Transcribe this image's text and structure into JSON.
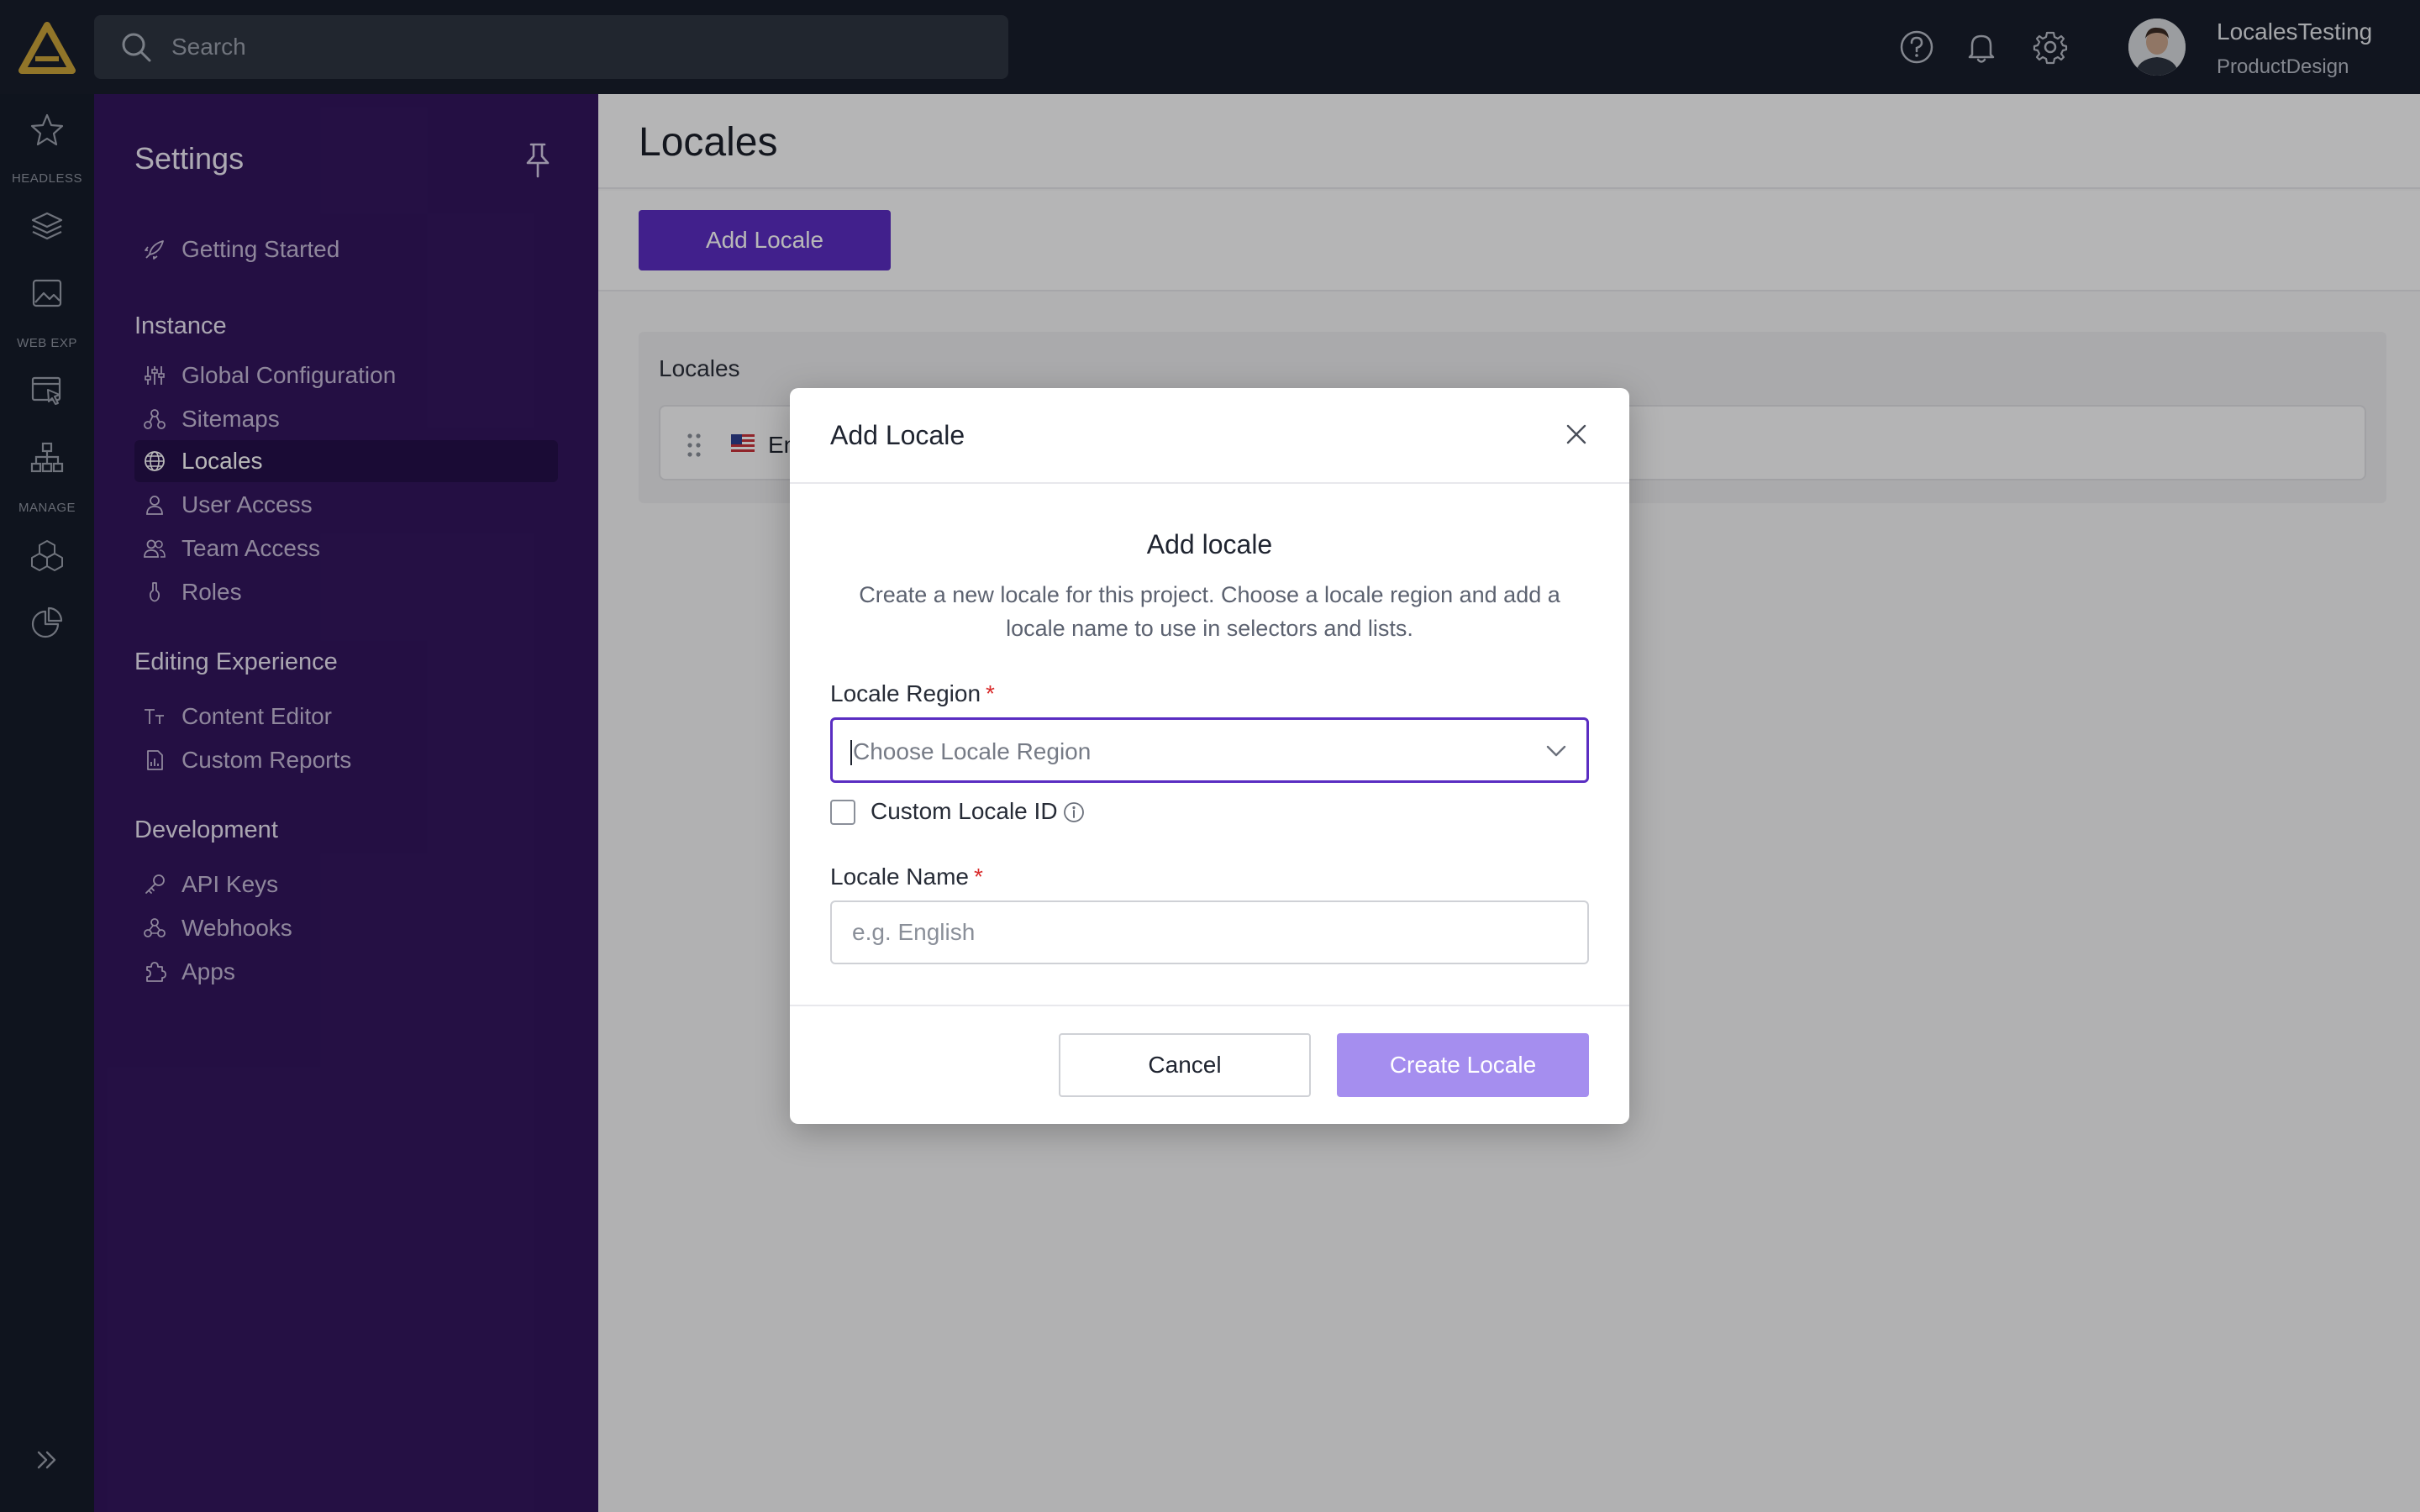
{
  "topbar": {
    "search_placeholder": "Search",
    "icons": [
      "help-icon",
      "bell-icon",
      "gear-icon"
    ],
    "user": {
      "name": "LocalesTesting",
      "org": "ProductDesign"
    }
  },
  "rail": {
    "labels": {
      "headless": "HEADLESS",
      "web_exp": "WEB EXP",
      "manage": "MANAGE"
    },
    "icons": [
      "star-icon",
      "layers-icon",
      "image-icon",
      "web-experience-icon",
      "sitemap-icon",
      "cubes-icon",
      "pie-chart-icon",
      "expand-icon"
    ]
  },
  "settings": {
    "title": "Settings",
    "getting_started": "Getting Started",
    "groups": {
      "instance": {
        "title": "Instance",
        "items": [
          "Global Configuration",
          "Sitemaps",
          "Locales",
          "User Access",
          "Team Access",
          "Roles"
        ]
      },
      "editing": {
        "title": "Editing Experience",
        "items": [
          "Content Editor",
          "Custom Reports"
        ]
      },
      "development": {
        "title": "Development",
        "items": [
          "API Keys",
          "Webhooks",
          "Apps"
        ]
      }
    },
    "active_item": "Locales"
  },
  "main": {
    "page_title": "Locales",
    "add_button": "Add Locale",
    "card_title": "Locales",
    "row_label": "En"
  },
  "modal": {
    "title": "Add Locale",
    "heading": "Add locale",
    "description": "Create a new locale for this project. Choose a locale region and add a locale name to use in selectors and lists.",
    "region_label": "Locale Region",
    "region_placeholder": "Choose Locale Region",
    "required_mark": "*",
    "custom_id_label": "Custom Locale ID",
    "name_label": "Locale Name",
    "name_placeholder": "e.g. English",
    "cancel": "Cancel",
    "create": "Create Locale"
  },
  "colors": {
    "topbar": "#181e2c",
    "settings_panel": "#33165e",
    "accent": "#5a2dc2",
    "create_disabled": "#a58eef",
    "logo": "#c9a33a",
    "required": "#d92c2c"
  }
}
